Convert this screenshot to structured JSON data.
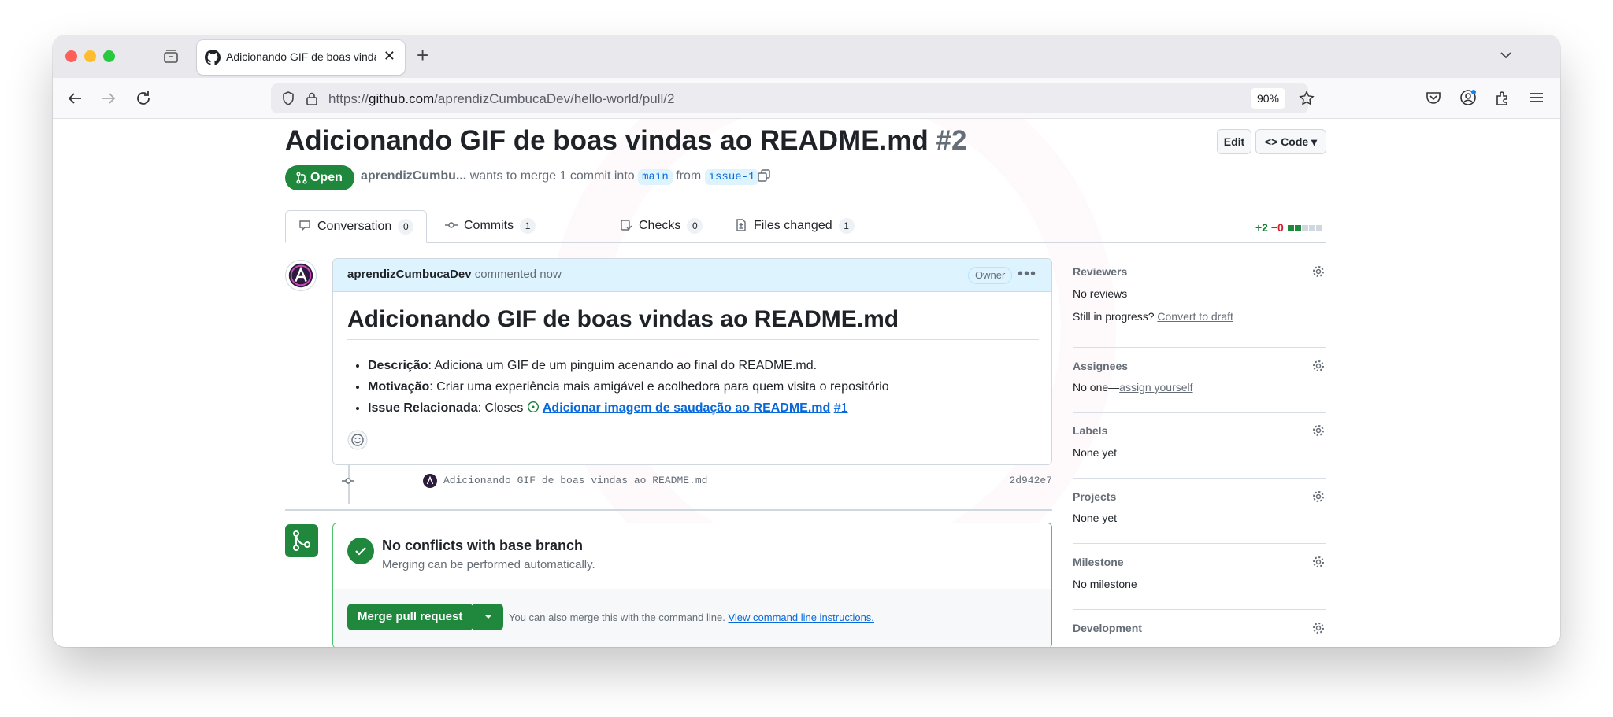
{
  "browser": {
    "tab_title": "Adicionando GIF de boas vindas ao README.md",
    "url_prefix": "https://",
    "url_host": "github.com",
    "url_path": "/aprendizCumbucaDev/hello-world/pull/2",
    "zoom": "90%"
  },
  "pr": {
    "title": "Adicionando GIF de boas vindas ao README.md",
    "number": "#2",
    "edit_label": "Edit",
    "code_label": "Code",
    "state": "Open",
    "author": "aprendizCumbu...",
    "merge_text": "wants to merge 1 commit into",
    "base_branch": "main",
    "from_text": "from",
    "head_branch": "issue-1"
  },
  "tabs": [
    {
      "label": "Conversation",
      "count": "0"
    },
    {
      "label": "Commits",
      "count": "1"
    },
    {
      "label": "Checks",
      "count": "0"
    },
    {
      "label": "Files changed",
      "count": "1"
    }
  ],
  "diffstat": {
    "additions": "+2",
    "deletions": "−0"
  },
  "comment": {
    "author": "aprendizCumbucaDev",
    "action": "commented now",
    "badge": "Owner",
    "heading": "Adicionando GIF de boas vindas ao README.md",
    "items": [
      {
        "label": "Descrição",
        "text": ": Adiciona um GIF de um pinguim acenando ao final do README.md."
      },
      {
        "label": "Motivação",
        "text": ": Criar uma experiência mais amigável e acolhedora para quem visita o repositório"
      },
      {
        "label": "Issue Relacionada",
        "text": ": Closes "
      }
    ],
    "issue_link": "Adicionar imagem de saudação ao README.md",
    "issue_number": "#1"
  },
  "commit": {
    "message": "Adicionando GIF de boas vindas ao README.md",
    "sha": "2d942e7"
  },
  "merge": {
    "title": "No conflicts with base branch",
    "subtitle": "Merging can be performed automatically.",
    "button": "Merge pull request",
    "hint": "You can also merge this with the command line.",
    "hint_link": "View command line instructions."
  },
  "sidebar": {
    "reviewers": {
      "heading": "Reviewers",
      "value": "No reviews",
      "progress_text": "Still in progress?",
      "draft_link": "Convert to draft"
    },
    "assignees": {
      "heading": "Assignees",
      "value": "No one—",
      "assign_link": "assign yourself"
    },
    "labels": {
      "heading": "Labels",
      "value": "None yet"
    },
    "projects": {
      "heading": "Projects",
      "value": "None yet"
    },
    "milestone": {
      "heading": "Milestone",
      "value": "No milestone"
    },
    "development": {
      "heading": "Development"
    }
  },
  "colors": {
    "open_green": "#1f883d",
    "link_blue": "#0969da",
    "deletion_red": "#cf222e"
  }
}
